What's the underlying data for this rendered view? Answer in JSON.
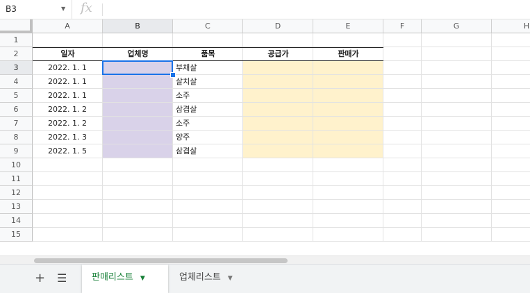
{
  "formula_bar": {
    "cell_ref": "B3",
    "fx_label": "fx",
    "formula": ""
  },
  "columns": [
    "A",
    "B",
    "C",
    "D",
    "E",
    "F",
    "G",
    "H"
  ],
  "rows": [
    "1",
    "2",
    "3",
    "4",
    "5",
    "6",
    "7",
    "8",
    "9",
    "10",
    "11",
    "12",
    "13",
    "14",
    "15"
  ],
  "selected_cell": {
    "col": "B",
    "row": "3"
  },
  "table": {
    "headers": [
      "일자",
      "업체명",
      "품목",
      "공급가",
      "판매가"
    ],
    "records": [
      {
        "date": "2022. 1. 1",
        "vendor": "",
        "item": "부채살",
        "supply_price": "",
        "sale_price": ""
      },
      {
        "date": "2022. 1. 1",
        "vendor": "",
        "item": "살치살",
        "supply_price": "",
        "sale_price": ""
      },
      {
        "date": "2022. 1. 1",
        "vendor": "",
        "item": "소주",
        "supply_price": "",
        "sale_price": ""
      },
      {
        "date": "2022. 1. 2",
        "vendor": "",
        "item": "삼겹살",
        "supply_price": "",
        "sale_price": ""
      },
      {
        "date": "2022. 1. 2",
        "vendor": "",
        "item": "소주",
        "supply_price": "",
        "sale_price": ""
      },
      {
        "date": "2022. 1. 3",
        "vendor": "",
        "item": "양주",
        "supply_price": "",
        "sale_price": ""
      },
      {
        "date": "2022. 1. 5",
        "vendor": "",
        "item": "삼겹살",
        "supply_price": "",
        "sale_price": ""
      }
    ]
  },
  "colors": {
    "vendor_fill": "#d9d2e9",
    "price_fill": "#fff2cc",
    "selection": "#1a73e8",
    "active_tab": "#188038"
  },
  "sheet_tabs": {
    "add_icon": "plus-icon",
    "list_icon": "menu-icon",
    "tabs": [
      {
        "label": "판매리스트",
        "active": true
      },
      {
        "label": "업체리스트",
        "active": false
      }
    ]
  }
}
